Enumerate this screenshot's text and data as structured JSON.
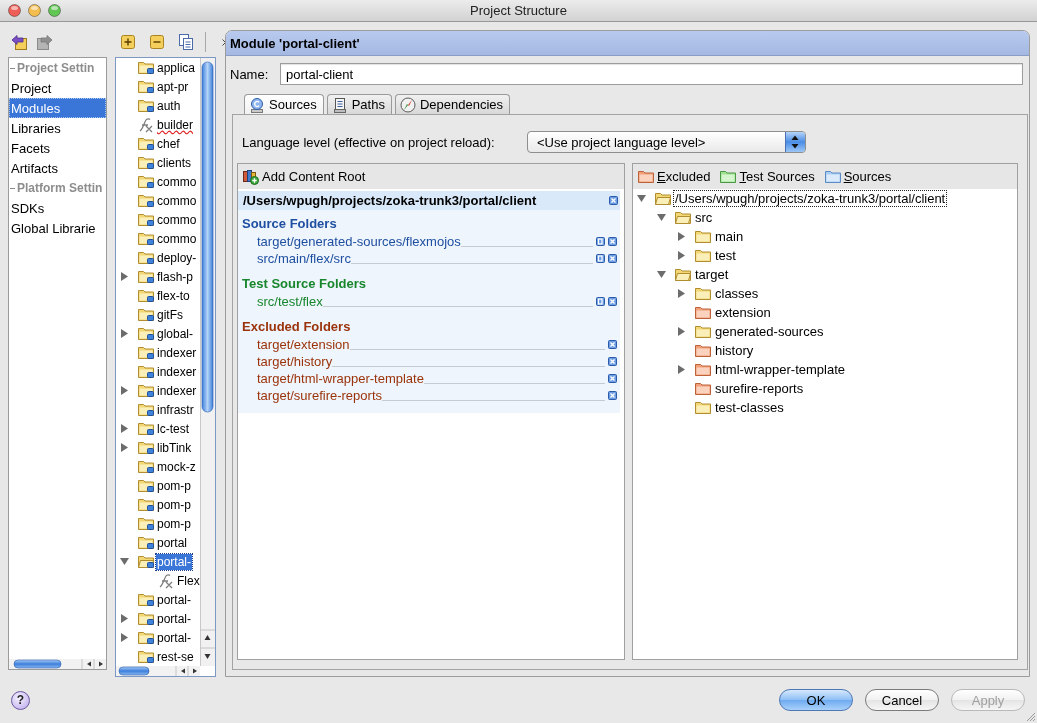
{
  "window": {
    "title": "Project Structure"
  },
  "nav_buttons": [
    {
      "kind": "back",
      "disabled": false
    },
    {
      "kind": "forward",
      "disabled": true
    }
  ],
  "sidebar": {
    "groups": [
      {
        "title": "Project Settin",
        "items": [
          {
            "label": "Project",
            "selected": false
          },
          {
            "label": "Modules",
            "selected": true
          },
          {
            "label": "Libraries",
            "selected": false
          },
          {
            "label": "Facets",
            "selected": false
          },
          {
            "label": "Artifacts",
            "selected": false
          }
        ]
      },
      {
        "title": "Platform Settin",
        "items": [
          {
            "label": "SDKs",
            "selected": false
          },
          {
            "label": "Global Librarie",
            "selected": false
          }
        ]
      }
    ]
  },
  "module_tree": [
    {
      "label": "applica",
      "kind": "module",
      "selected": false,
      "misspelled": false
    },
    {
      "label": "apt-pr",
      "kind": "module",
      "selected": false,
      "misspelled": false
    },
    {
      "label": "auth",
      "kind": "module",
      "selected": false,
      "misspelled": false
    },
    {
      "label": "builder",
      "kind": "flex",
      "selected": false,
      "misspelled": true
    },
    {
      "label": "chef",
      "kind": "module",
      "selected": false,
      "misspelled": false
    },
    {
      "label": "clients",
      "kind": "module",
      "selected": false,
      "misspelled": false
    },
    {
      "label": "commo",
      "kind": "module",
      "selected": false,
      "misspelled": false
    },
    {
      "label": "commo",
      "kind": "module",
      "selected": false,
      "misspelled": false
    },
    {
      "label": "commo",
      "kind": "module",
      "selected": false,
      "misspelled": false
    },
    {
      "label": "commo",
      "kind": "module",
      "selected": false,
      "misspelled": false
    },
    {
      "label": "deploy-",
      "kind": "module",
      "selected": false,
      "misspelled": false
    },
    {
      "label": "flash-p",
      "kind": "module",
      "expanded": false,
      "selected": false,
      "misspelled": false
    },
    {
      "label": "flex-to",
      "kind": "module",
      "selected": false,
      "misspelled": false
    },
    {
      "label": "gitFs",
      "kind": "module",
      "selected": false,
      "misspelled": false
    },
    {
      "label": "global-",
      "kind": "module",
      "expanded": false,
      "selected": false,
      "misspelled": false
    },
    {
      "label": "indexer",
      "kind": "module",
      "selected": false,
      "misspelled": false
    },
    {
      "label": "indexer",
      "kind": "module",
      "selected": false,
      "misspelled": false
    },
    {
      "label": "indexer",
      "kind": "module",
      "expanded": false,
      "selected": false,
      "misspelled": false
    },
    {
      "label": "infrastr",
      "kind": "module",
      "selected": false,
      "misspelled": false
    },
    {
      "label": "lc-test",
      "kind": "module",
      "expanded": false,
      "selected": false,
      "misspelled": false
    },
    {
      "label": "libTink",
      "kind": "module",
      "expanded": false,
      "selected": false,
      "misspelled": false
    },
    {
      "label": "mock-z",
      "kind": "module",
      "selected": false,
      "misspelled": false
    },
    {
      "label": "pom-p",
      "kind": "module",
      "selected": false,
      "misspelled": false
    },
    {
      "label": "pom-p",
      "kind": "module",
      "selected": false,
      "misspelled": false
    },
    {
      "label": "pom-p",
      "kind": "module",
      "selected": false,
      "misspelled": false
    },
    {
      "label": "portal",
      "kind": "module",
      "selected": false,
      "misspelled": false
    },
    {
      "label": "portal-",
      "kind": "module",
      "expanded": true,
      "selected": true,
      "misspelled": false,
      "children": [
        {
          "label": "Flex",
          "kind": "flex",
          "selected": false,
          "misspelled": false
        }
      ]
    },
    {
      "label": "portal-",
      "kind": "module",
      "selected": false,
      "misspelled": false
    },
    {
      "label": "portal-",
      "kind": "module",
      "expanded": false,
      "selected": false,
      "misspelled": false
    },
    {
      "label": "portal-",
      "kind": "module",
      "expanded": false,
      "selected": false,
      "misspelled": false
    },
    {
      "label": "rest-se",
      "kind": "module",
      "selected": false,
      "misspelled": false
    }
  ],
  "module": {
    "title": "Module 'portal-client'",
    "name_label": "Name:",
    "name_value": "portal-client"
  },
  "tabs": [
    {
      "label": "Sources",
      "kind": "sources",
      "selected": true
    },
    {
      "label": "Paths",
      "kind": "paths",
      "selected": false
    },
    {
      "label": "Dependencies",
      "kind": "dependencies",
      "selected": false
    }
  ],
  "language_level": {
    "label": "Language level (effective on project reload):",
    "value": "<Use project language level>"
  },
  "content_roots": {
    "add_label": "Add Content Root",
    "root_path": "/Users/wpugh/projects/zoka-trunk3/portal/client",
    "groups": [
      {
        "kind": "source",
        "title": "Source Folders",
        "folders": [
          "target/generated-sources/flexmojos",
          "src/main/flex/src"
        ]
      },
      {
        "kind": "test",
        "title": "Test Source Folders",
        "folders": [
          "src/test/flex"
        ]
      },
      {
        "kind": "excluded",
        "title": "Excluded Folders",
        "folders": [
          "target/extension",
          "target/history",
          "target/html-wrapper-template",
          "target/surefire-reports"
        ]
      }
    ]
  },
  "folder_tree": {
    "legend": [
      {
        "kind": "excluded",
        "label": "Excluded"
      },
      {
        "kind": "test",
        "label": "Test Sources"
      },
      {
        "kind": "source",
        "label": "Sources"
      }
    ],
    "nodes": [
      {
        "label": "/Users/wpugh/projects/zoka-trunk3/portal/client",
        "kind": "plain",
        "expanded": true,
        "focused": true,
        "children": [
          {
            "label": "src",
            "kind": "plain",
            "expanded": true,
            "focused": false,
            "children": [
              {
                "label": "main",
                "kind": "plain",
                "expanded": false,
                "focused": false
              },
              {
                "label": "test",
                "kind": "plain",
                "expanded": false,
                "focused": false
              }
            ]
          },
          {
            "label": "target",
            "kind": "plain",
            "expanded": true,
            "focused": false,
            "children": [
              {
                "label": "classes",
                "kind": "plain",
                "expanded": false,
                "focused": false
              },
              {
                "label": "extension",
                "kind": "excluded",
                "focused": false
              },
              {
                "label": "generated-sources",
                "kind": "plain",
                "expanded": false,
                "focused": false
              },
              {
                "label": "history",
                "kind": "excluded",
                "focused": false
              },
              {
                "label": "html-wrapper-template",
                "kind": "excluded",
                "expanded": false,
                "focused": false
              },
              {
                "label": "surefire-reports",
                "kind": "excluded",
                "focused": false
              },
              {
                "label": "test-classes",
                "kind": "plain",
                "focused": false
              }
            ]
          }
        ]
      }
    ]
  },
  "help_button": "?",
  "buttons": [
    {
      "label": "OK",
      "kind": "default",
      "disabled": false
    },
    {
      "label": "Cancel",
      "kind": "normal",
      "disabled": false
    },
    {
      "label": "Apply",
      "kind": "normal",
      "disabled": true
    }
  ]
}
